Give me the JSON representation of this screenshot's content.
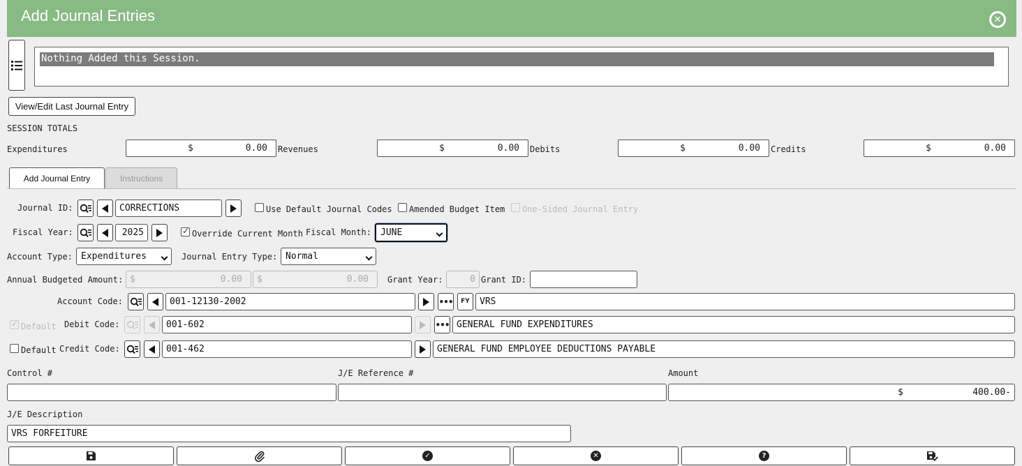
{
  "header": {
    "title": "Add Journal Entries"
  },
  "session": {
    "message": "Nothing Added this Session."
  },
  "buttons": {
    "view_edit_last": "View/Edit Last Journal Entry"
  },
  "totals": {
    "heading": "SESSION TOTALS",
    "expenditures": {
      "label": "Expenditures",
      "currency": "$",
      "value": "0.00"
    },
    "revenues": {
      "label": "Revenues",
      "currency": "$",
      "value": "0.00"
    },
    "debits": {
      "label": "Debits",
      "currency": "$",
      "value": "0.00"
    },
    "credits": {
      "label": "Credits",
      "currency": "$",
      "value": "0.00"
    }
  },
  "tabs": [
    {
      "label": "Add Journal Entry",
      "active": true
    },
    {
      "label": "Instructions",
      "active": false
    }
  ],
  "form": {
    "journal_id": {
      "label": "Journal ID:",
      "value": "CORRECTIONS"
    },
    "use_default_codes": {
      "label": "Use Default Journal Codes",
      "checked": false
    },
    "amended_budget": {
      "label": "Amended Budget Item",
      "checked": false
    },
    "one_sided": {
      "label": "One-Sided Journal Entry",
      "checked": false,
      "disabled": true
    },
    "fiscal_year": {
      "label": "Fiscal Year:",
      "value": "2025"
    },
    "override_month": {
      "label": "Override Current Month",
      "checked": true
    },
    "fiscal_month": {
      "label": "Fiscal Month:",
      "value": "JUNE"
    },
    "account_type": {
      "label": "Account Type:",
      "value": "Expenditures"
    },
    "je_type": {
      "label": "Journal Entry Type:",
      "value": "Normal"
    },
    "annual_budgeted": {
      "label": "Annual Budgeted Amount:",
      "currency": "$",
      "value1": "0.00",
      "value2": "0.00"
    },
    "grant_year": {
      "label": "Grant Year:",
      "value": "0"
    },
    "grant_id": {
      "label": "Grant ID:",
      "value": ""
    },
    "account_code": {
      "label": "Account Code:",
      "value": "001-12130-2002",
      "fy_label": "FY",
      "description": "VRS"
    },
    "debit_code": {
      "default_label": "Default",
      "default_checked": true,
      "label": "Debit Code:",
      "value": "001-602",
      "description": "GENERAL FUND EXPENDITURES"
    },
    "credit_code": {
      "default_label": "Default",
      "default_checked": false,
      "label": "Credit Code:",
      "value": "001-462",
      "description": "GENERAL FUND EMPLOYEE DEDUCTIONS PAYABLE"
    },
    "control_no": {
      "label": "Control #",
      "value": ""
    },
    "je_reference": {
      "label": "J/E Reference #",
      "value": ""
    },
    "amount": {
      "label": "Amount",
      "currency": "$",
      "value": "400.00-"
    },
    "je_description": {
      "label": "J/E Description",
      "value": "VRS FORFEITURE"
    }
  },
  "actions": [
    "save-icon",
    "paperclip-icon",
    "check-circle-icon",
    "x-circle-icon",
    "question-circle-icon",
    "save-check-icon"
  ],
  "colors": {
    "header_bg": "#88ba84",
    "session_line_bg": "#7b7b7b"
  }
}
